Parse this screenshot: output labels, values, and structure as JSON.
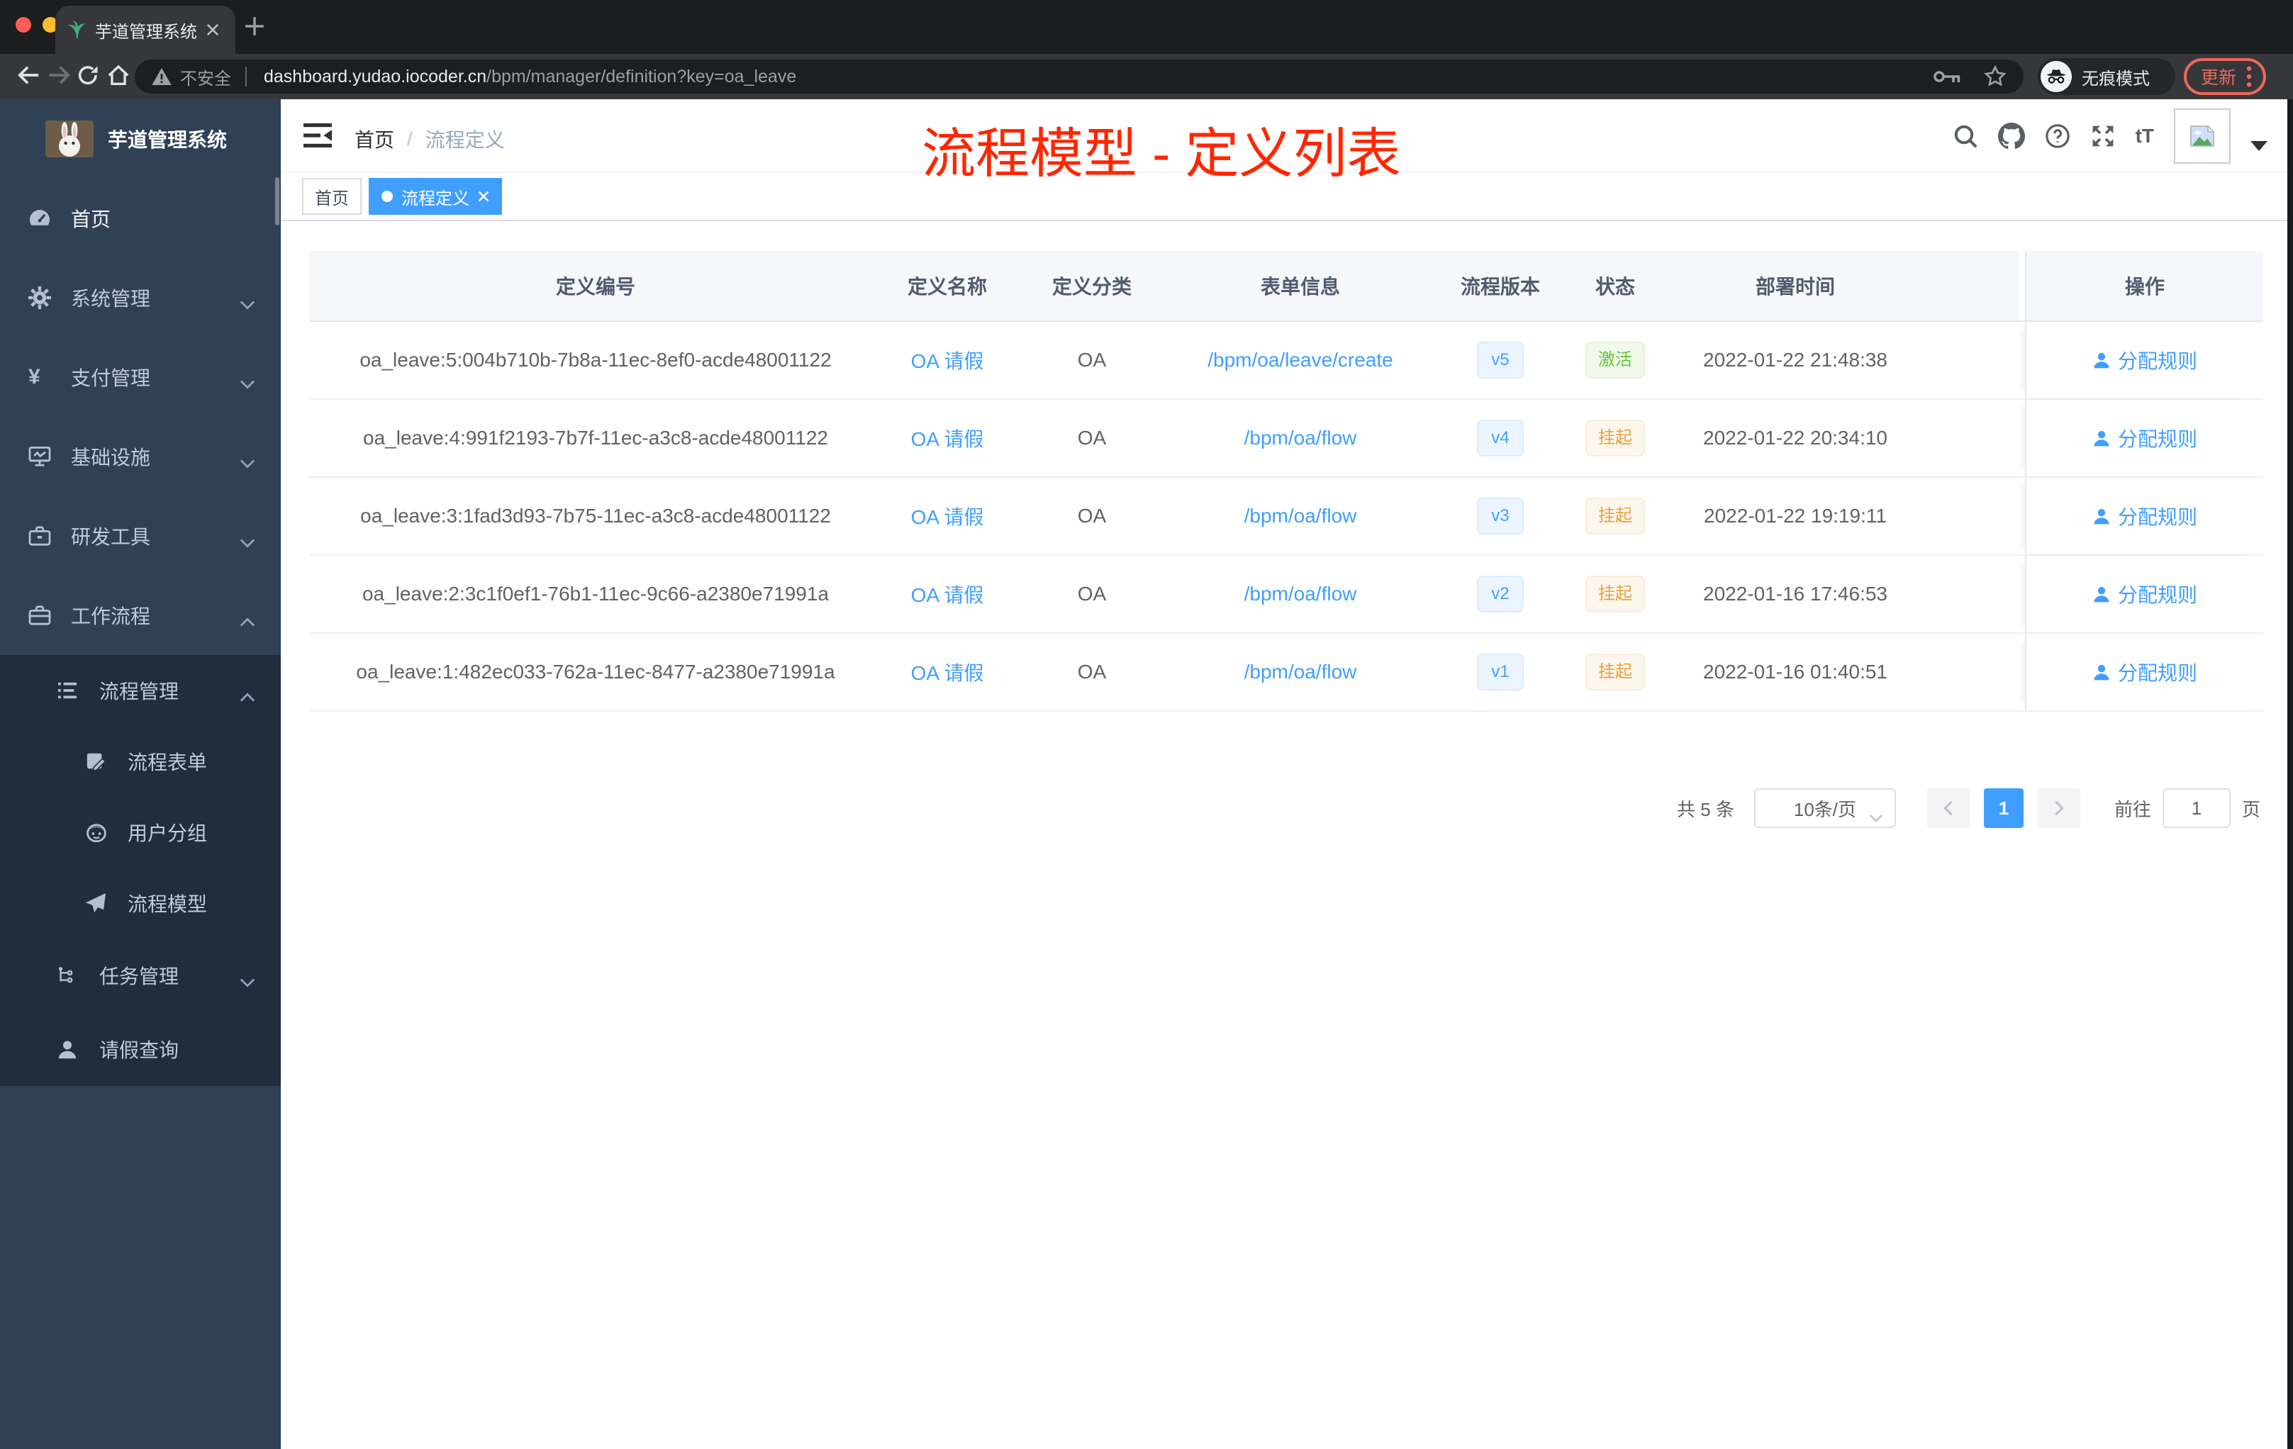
{
  "browser": {
    "tab_title": "芋道管理系统",
    "security_label": "不安全",
    "url_host": "dashboard.yudao.iocoder.cn",
    "url_path": "/bpm/manager/definition?key=oa_leave",
    "incognito_label": "无痕模式",
    "update_label": "更新"
  },
  "sidebar": {
    "title": "芋道管理系统",
    "items": [
      {
        "label": "首页",
        "icon": "dashboard-icon"
      },
      {
        "label": "系统管理",
        "icon": "gear-icon"
      },
      {
        "label": "支付管理",
        "icon": "yen-icon",
        "glyph": "¥"
      },
      {
        "label": "基础设施",
        "icon": "monitor-icon"
      },
      {
        "label": "研发工具",
        "icon": "toolbox-icon"
      },
      {
        "label": "工作流程",
        "icon": "briefcase-icon",
        "expanded": true
      }
    ],
    "workflow_menu": {
      "process_group": {
        "label": "流程管理",
        "children": [
          {
            "label": "流程表单",
            "icon": "form-document-icon"
          },
          {
            "label": "用户分组",
            "icon": "user-group-icon"
          },
          {
            "label": "流程模型",
            "icon": "paper-plane-icon"
          }
        ]
      },
      "task_group": {
        "label": "任务管理"
      },
      "leave_item": {
        "label": "请假查询"
      }
    }
  },
  "header": {
    "breadcrumb": [
      {
        "label": "首页"
      },
      {
        "label": "流程定义"
      }
    ],
    "separator": "/",
    "annotation": "流程模型 - 定义列表",
    "font_size_icon_label": "tT"
  },
  "tags": [
    {
      "label": "首页",
      "active": false
    },
    {
      "label": "流程定义",
      "active": true
    }
  ],
  "table": {
    "columns": [
      "定义编号",
      "定义名称",
      "定义分类",
      "表单信息",
      "流程版本",
      "状态",
      "部署时间",
      "操作"
    ],
    "rows": [
      {
        "id": "oa_leave:5:004b710b-7b8a-11ec-8ef0-acde48001122",
        "name": "OA 请假",
        "category": "OA",
        "form": "/bpm/oa/leave/create",
        "version": "v5",
        "status": "激活",
        "deploy_time": "2022-01-22 21:48:38",
        "action": "分配规则"
      },
      {
        "id": "oa_leave:4:991f2193-7b7f-11ec-a3c8-acde48001122",
        "name": "OA 请假",
        "category": "OA",
        "form": "/bpm/oa/flow",
        "version": "v4",
        "status": "挂起",
        "deploy_time": "2022-01-22 20:34:10",
        "action": "分配规则"
      },
      {
        "id": "oa_leave:3:1fad3d93-7b75-11ec-a3c8-acde48001122",
        "name": "OA 请假",
        "category": "OA",
        "form": "/bpm/oa/flow",
        "version": "v3",
        "status": "挂起",
        "deploy_time": "2022-01-22 19:19:11",
        "action": "分配规则"
      },
      {
        "id": "oa_leave:2:3c1f0ef1-76b1-11ec-9c66-a2380e71991a",
        "name": "OA 请假",
        "category": "OA",
        "form": "/bpm/oa/flow",
        "version": "v2",
        "status": "挂起",
        "deploy_time": "2022-01-16 17:46:53",
        "action": "分配规则"
      },
      {
        "id": "oa_leave:1:482ec033-762a-11ec-8477-a2380e71991a",
        "name": "OA 请假",
        "category": "OA",
        "form": "/bpm/oa/flow",
        "version": "v1",
        "status": "挂起",
        "deploy_time": "2022-01-16 01:40:51",
        "action": "分配规则"
      }
    ]
  },
  "pagination": {
    "total": "共 5 条",
    "page_size": "10条/页",
    "current": "1",
    "goto_label": "前往",
    "goto_value": "1",
    "unit_label": "页"
  },
  "colors": {
    "accent": "#409eff",
    "success_green": "#67c23a",
    "warning_orange": "#e6a23c",
    "annotation_red": "#ff2600",
    "sidebar_bg": "#304156",
    "submenu_bg": "#1f2d3d"
  }
}
